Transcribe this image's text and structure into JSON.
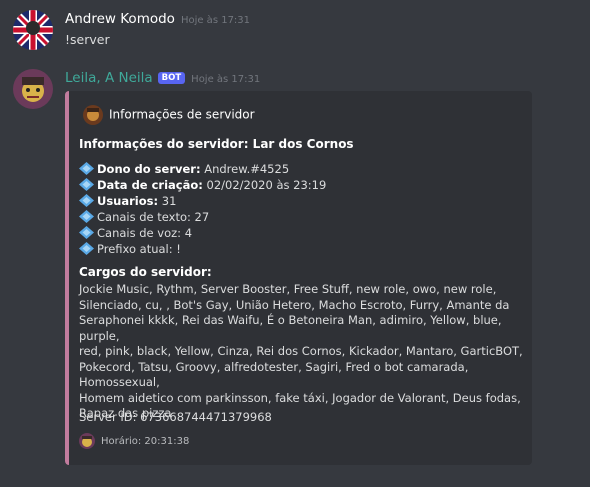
{
  "messages": [
    {
      "author": "Andrew Komodo",
      "timestamp": "Hoje às 17:31",
      "text": "!server"
    },
    {
      "author": "Leila, A Neila",
      "bot_tag": "BOT",
      "timestamp": "Hoje às 17:31",
      "author_color": "#3fa99a"
    }
  ],
  "embed": {
    "border_color": "#c27c9e",
    "author": "Informações de servidor",
    "title": "Informações do servidor: Lar dos Cornos",
    "fields": [
      {
        "label": "Dono do server:",
        "value": " Andrew.#4525",
        "bold": true
      },
      {
        "label": "Data de criação:",
        "value": " 02/02/2020 às 23:19",
        "bold": true
      },
      {
        "label": "Usuarios:",
        "value": " 31",
        "bold": true
      },
      {
        "label": "",
        "value": "Canais de texto: 27",
        "bold": false
      },
      {
        "label": "",
        "value": "Canais de voz: 4",
        "bold": false
      },
      {
        "label": "",
        "value": "Prefixo atual: !",
        "bold": false
      }
    ],
    "roles_title": "Cargos do servidor:",
    "roles_lines": [
      "Jockie Music, Rythm, Server Booster, Free Stuff, new role, owo, new role,",
      "Silenciado, cu, , Bot's Gay, União Hetero, Macho Escroto, Furry, Amante da",
      "Seraphonei kkkk, Rei das Waifu, É o Betoneira Man, adimiro, Yellow, blue, purple,",
      "red, pink, black, Yellow, Cinza, Rei dos Cornos, Kickador, Mantaro, GarticBOT,",
      "Pokecord, Tatsu, Groovy, alfredotester, Sagiri, Fred o bot camarada, Homossexual,",
      "Homem aidetico com parkinsson, fake táxi, Jogador de Valorant, Deus fodas,",
      "Rapaz das pizza"
    ],
    "server_id": "Server ID: 673668744471379968",
    "footer": "Horário: 20:31:38"
  },
  "icons": {
    "field_bullet": "large-blue-diamond-icon"
  }
}
